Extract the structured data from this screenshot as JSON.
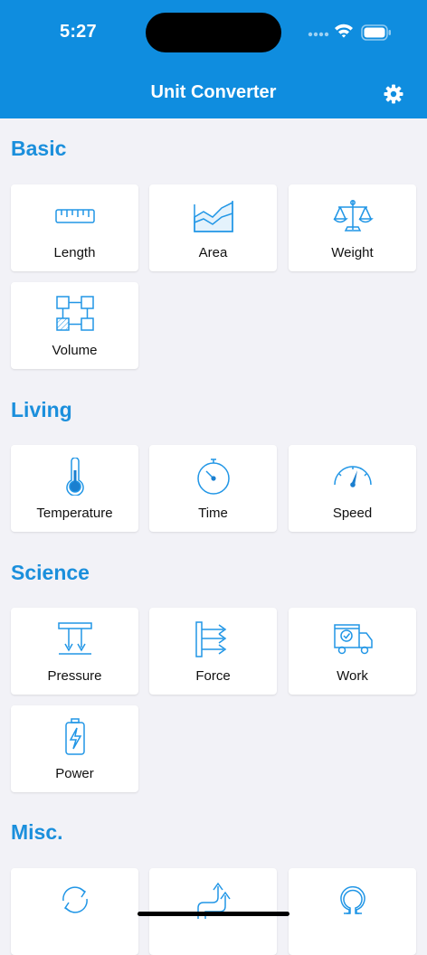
{
  "status_bar": {
    "time": "5:27"
  },
  "header": {
    "title": "Unit Converter"
  },
  "colors": {
    "accent": "#0f8ddf",
    "section": "#1b8fdc",
    "icon": "#2196e6",
    "background": "#f2f2f7"
  },
  "sections": {
    "basic": {
      "title": "Basic",
      "items": [
        {
          "label": "Length",
          "icon": "ruler-icon"
        },
        {
          "label": "Area",
          "icon": "area-chart-icon"
        },
        {
          "label": "Weight",
          "icon": "scale-icon"
        },
        {
          "label": "Volume",
          "icon": "blocks-icon"
        }
      ]
    },
    "living": {
      "title": "Living",
      "items": [
        {
          "label": "Temperature",
          "icon": "thermometer-icon"
        },
        {
          "label": "Time",
          "icon": "stopwatch-icon"
        },
        {
          "label": "Speed",
          "icon": "speedometer-icon"
        }
      ]
    },
    "science": {
      "title": "Science",
      "items": [
        {
          "label": "Pressure",
          "icon": "pressure-icon"
        },
        {
          "label": "Force",
          "icon": "force-icon"
        },
        {
          "label": "Work",
          "icon": "delivery-truck-icon"
        },
        {
          "label": "Power",
          "icon": "battery-charge-icon"
        }
      ]
    },
    "misc": {
      "title": "Misc.",
      "items": [
        {
          "icon": "refresh-icon"
        },
        {
          "icon": "arrows-flow-icon"
        },
        {
          "icon": "omega-icon"
        }
      ]
    }
  }
}
